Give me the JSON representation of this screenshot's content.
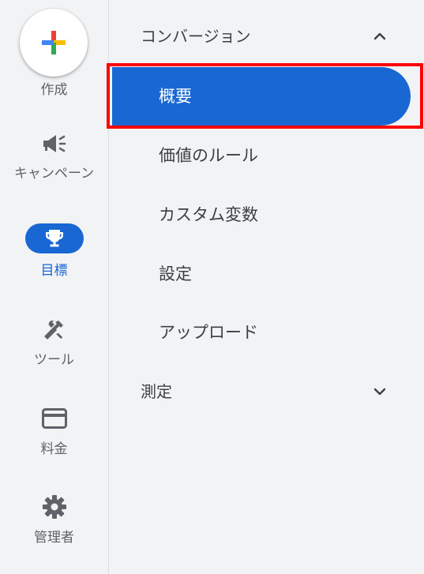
{
  "rail": {
    "items": [
      {
        "label": "作成",
        "icon": "plus-icon"
      },
      {
        "label": "キャンペーン",
        "icon": "megaphone-icon"
      },
      {
        "label": "目標",
        "icon": "trophy-icon",
        "active": true
      },
      {
        "label": "ツール",
        "icon": "tools-icon"
      },
      {
        "label": "料金",
        "icon": "credit-card-icon"
      },
      {
        "label": "管理者",
        "icon": "gear-icon"
      }
    ]
  },
  "nav": {
    "conversions": {
      "label": "コンバージョン",
      "expanded": true,
      "items": [
        {
          "label": "概要",
          "active": true
        },
        {
          "label": "価値のルール"
        },
        {
          "label": "カスタム変数"
        },
        {
          "label": "設定"
        },
        {
          "label": "アップロード"
        }
      ]
    },
    "measurement": {
      "label": "測定",
      "expanded": false
    }
  },
  "colors": {
    "accent": "#1967d2",
    "highlight": "#ff0000",
    "background": "#f1f3f4",
    "text": "#3c4043"
  }
}
